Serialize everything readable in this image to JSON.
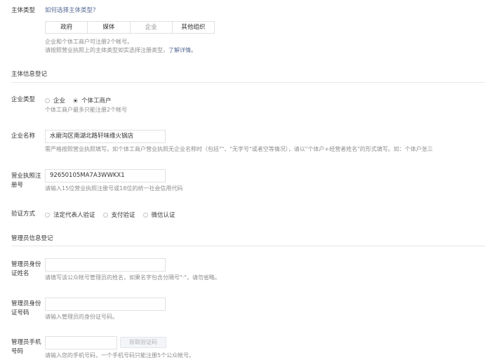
{
  "subject_type": {
    "label": "主体类型",
    "help_link": "如何选择主体类型?",
    "options": [
      "政府",
      "媒体",
      "企业",
      "其他组织"
    ],
    "selected": "企业",
    "hint_line1": "企业和个体工商户可注册2个帐号。",
    "hint_line2_prefix": "请按照营业执照上的主体类型如实选择注册类型，",
    "hint_line2_link": "了解详情。"
  },
  "subject_info_section": {
    "title": "主体信息登记"
  },
  "enterprise_type": {
    "label": "企业类型",
    "options": [
      "企业",
      "个体工商户"
    ],
    "selected": "个体工商户",
    "hint": "个体工商户最多只能注册2个帐号"
  },
  "enterprise_name": {
    "label": "企业名称",
    "value": "水磨沟区南湖北路轩味缘火锅店",
    "hint": "需严格按照营业执照填写。如个体工商户营业执照无企业名称时（包括\"\"、\"无字号\"或者空等情况），请以\"个体户+经营者姓名\"的形式填写。如：个体户张三"
  },
  "license_number": {
    "label_line1": "营业执照注",
    "label_line2": "册号",
    "value": "92650105MA7A3WWKX1",
    "hint": "请输入15位营业执照注册号或18位的统一社会信用代码"
  },
  "verification": {
    "label": "验证方式",
    "options": [
      "法定代表人验证",
      "支付验证",
      "微信认证"
    ]
  },
  "admin_section": {
    "title": "管理员信息登记"
  },
  "admin_name": {
    "label_line1": "管理员身份",
    "label_line2": "证姓名",
    "value": "",
    "hint": "请填写该公众帐号管理员的姓名，如果名字包含分隔号\"·\"，请勿省略。"
  },
  "admin_id": {
    "label_line1": "管理员身份",
    "label_line2": "证号码",
    "value": "",
    "hint": "请输入管理员的身份证号码。"
  },
  "admin_phone": {
    "label_line1": "管理员手机",
    "label_line2": "号码",
    "value": "",
    "button": "获取验证码",
    "hint": "请输入您的手机号码，一个手机号码只能注册5个公众帐号。"
  }
}
